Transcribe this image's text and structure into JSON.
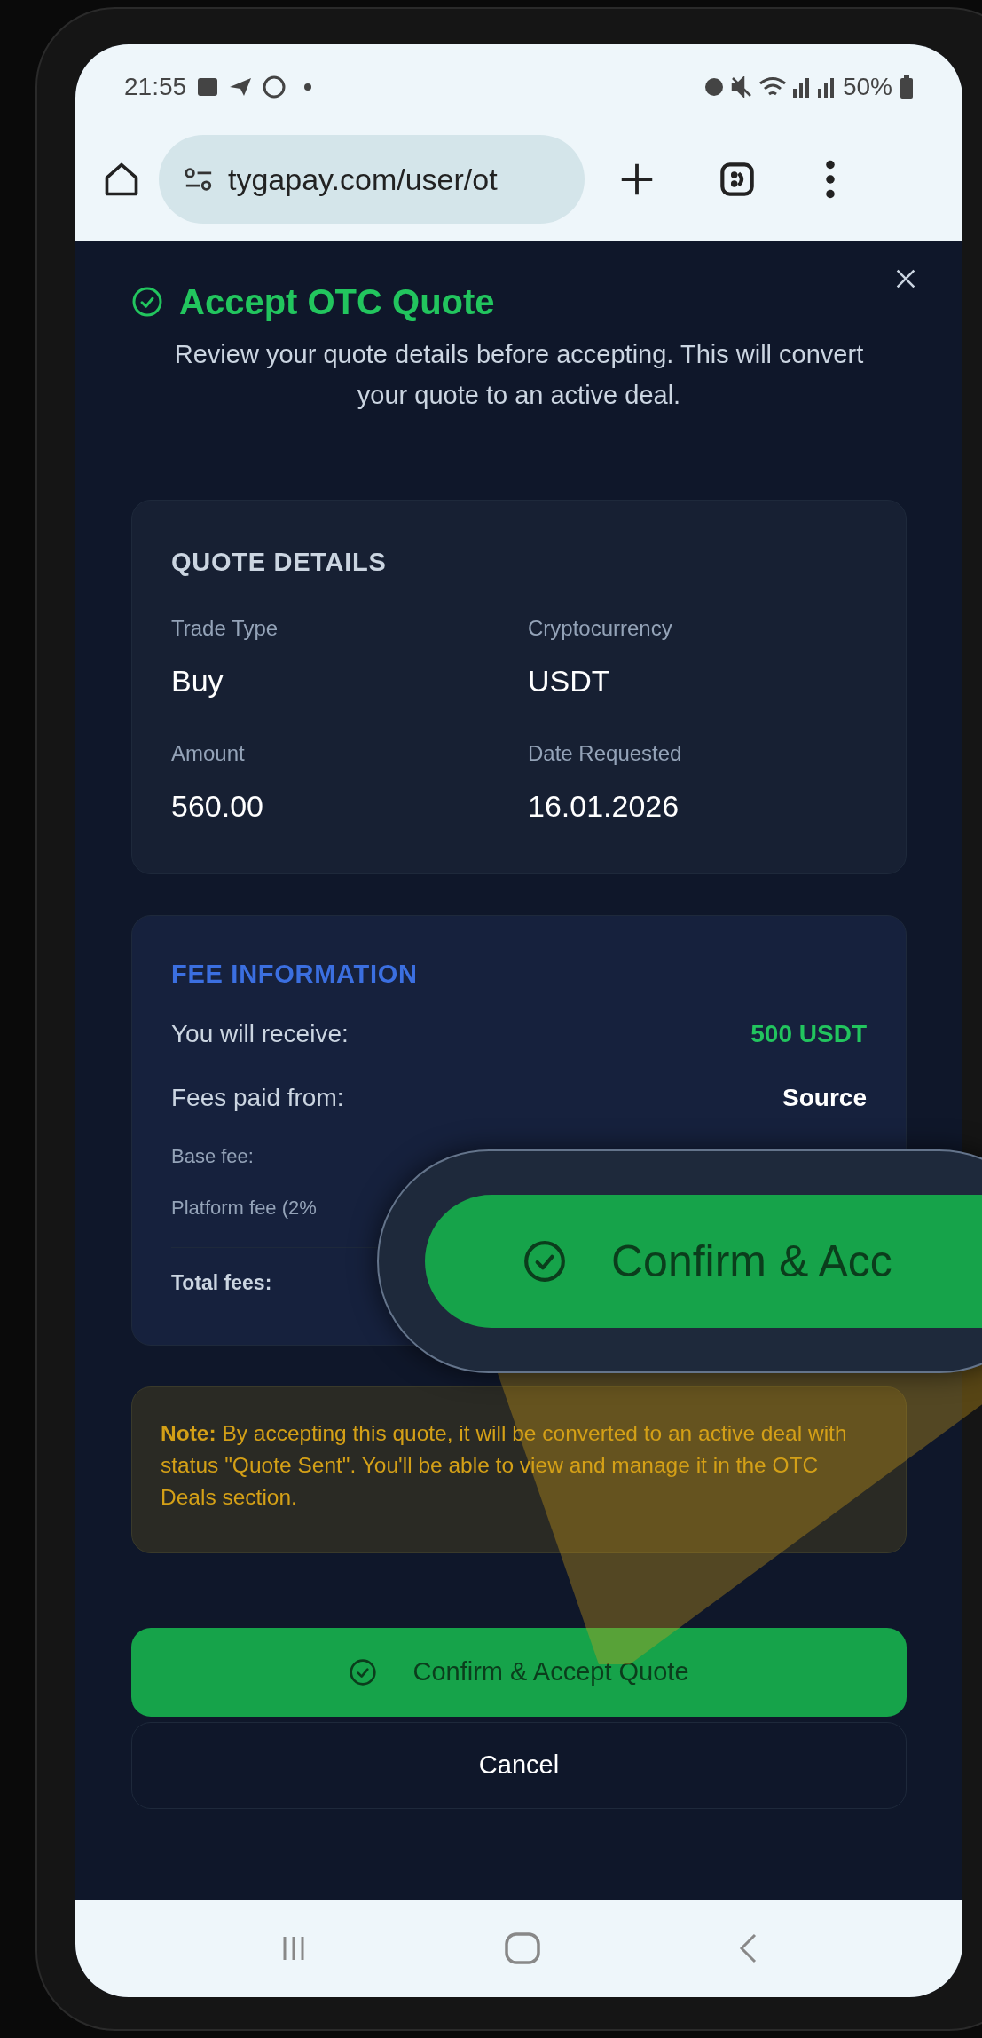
{
  "status_bar": {
    "time": "21:55",
    "battery": "50%"
  },
  "browser": {
    "url": "tygapay.com/user/ot"
  },
  "dialog": {
    "title": "Accept OTC Quote",
    "subtitle": "Review your quote details before accepting. This will convert your quote to an active deal.",
    "quote_details": {
      "heading": "QUOTE DETAILS",
      "fields": [
        {
          "label": "Trade Type",
          "value": "Buy"
        },
        {
          "label": "Cryptocurrency",
          "value": "USDT"
        },
        {
          "label": "Amount",
          "value": "560.00"
        },
        {
          "label": "Date Requested",
          "value": "16.01.2026"
        }
      ]
    },
    "fee_information": {
      "heading": "FEE INFORMATION",
      "rows": [
        {
          "kind": "large",
          "label": "You will receive:",
          "value": "500 USDT",
          "color": "#22c55e"
        },
        {
          "kind": "large",
          "label": "Fees paid from:",
          "value": "Source",
          "color": "#ffffff"
        },
        {
          "kind": "small",
          "label": "Base fee:"
        },
        {
          "kind": "small",
          "label": "Platform fee (2%"
        },
        {
          "kind": "total",
          "label": "Total fees:"
        }
      ]
    },
    "note": "**Note:** By accepting this quote, it will be converted to an active deal with status \"Quote Sent\". You'll be able to view and manage it in the OTC Deals section.",
    "confirm_button": "Confirm & Accept Quote",
    "cancel_button": "Cancel"
  },
  "magnifier": {
    "text": "Confirm & Acc"
  }
}
